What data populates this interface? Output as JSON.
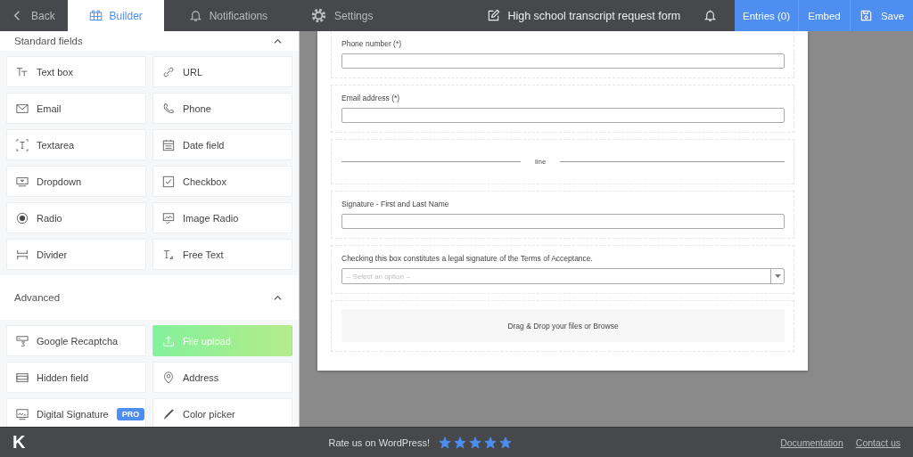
{
  "topbar": {
    "back": "Back",
    "tabs": [
      {
        "label": "Builder",
        "selected": true
      },
      {
        "label": "Notifications",
        "selected": false
      },
      {
        "label": "Settings",
        "selected": false
      }
    ],
    "form_title": "High school transcript request form",
    "buttons": [
      "Entries (0)",
      "Embed",
      "Save"
    ]
  },
  "sidebar": {
    "sections": [
      {
        "title": "Standard fields",
        "expanded": true,
        "items": [
          {
            "label": "Text box",
            "selected": false
          },
          {
            "label": "URL",
            "selected": false
          },
          {
            "label": "Email",
            "selected": false
          },
          {
            "label": "Phone",
            "selected": false
          },
          {
            "label": "Textarea",
            "selected": false
          },
          {
            "label": "Date field",
            "selected": false
          },
          {
            "label": "Dropdown",
            "selected": false
          },
          {
            "label": "Checkbox",
            "selected": false
          },
          {
            "label": "Radio",
            "selected": false
          },
          {
            "label": "Image Radio",
            "selected": false
          },
          {
            "label": "Divider",
            "selected": false
          },
          {
            "label": "Free Text",
            "selected": false
          }
        ]
      },
      {
        "title": "Advanced",
        "expanded": true,
        "items": [
          {
            "label": "Google Recaptcha",
            "selected": false
          },
          {
            "label": "File upload",
            "selected": true
          },
          {
            "label": "Hidden field",
            "selected": false
          },
          {
            "label": "Address",
            "selected": false
          },
          {
            "label": "Digital Signature",
            "selected": false,
            "badge": "PRO"
          },
          {
            "label": "Color picker",
            "selected": false
          }
        ]
      }
    ]
  },
  "form": {
    "fields": [
      {
        "kind": "text",
        "label": "Phone number (*)"
      },
      {
        "kind": "text",
        "label": "Email address (*)"
      },
      {
        "kind": "divider",
        "label": "line"
      },
      {
        "kind": "text",
        "label": "Signature - First and Last Name"
      },
      {
        "kind": "select",
        "label": "Checking this box constitutes a legal signature of the Terms of Acceptance.",
        "placeholder": "-- Select an option --"
      },
      {
        "kind": "upload",
        "label": "Drag & Drop your files or Browse"
      }
    ]
  },
  "footer": {
    "logo": "K",
    "rate_text": "Rate us on WordPress!",
    "stars": 5,
    "links": [
      "Documentation",
      "Contact us"
    ]
  }
}
